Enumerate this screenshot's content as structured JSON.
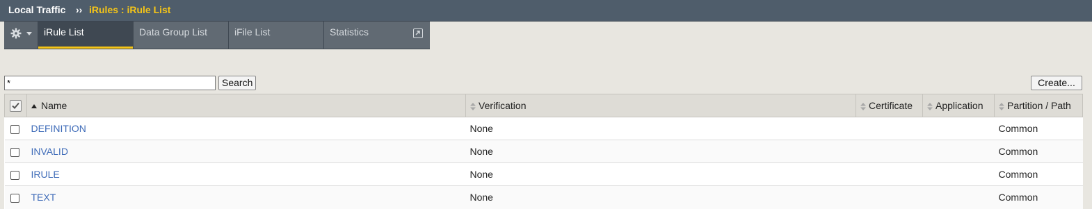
{
  "breadcrumb": {
    "root": "Local Traffic",
    "separator": "››",
    "current": "iRules : iRule List"
  },
  "tabs": [
    {
      "label": "iRule List",
      "active": true
    },
    {
      "label": "Data Group List",
      "active": false
    },
    {
      "label": "iFile List",
      "active": false
    },
    {
      "label": "Statistics",
      "active": false
    }
  ],
  "toolbar": {
    "search_value": "*",
    "search_label": "Search",
    "create_label": "Create..."
  },
  "table": {
    "headers": {
      "name": "Name",
      "verification": "Verification",
      "certificate": "Certificate",
      "application": "Application",
      "partition": "Partition / Path"
    },
    "rows": [
      {
        "name": "DEFINITION",
        "verification": "None",
        "certificate": "",
        "application": "",
        "partition": "Common"
      },
      {
        "name": "INVALID",
        "verification": "None",
        "certificate": "",
        "application": "",
        "partition": "Common"
      },
      {
        "name": "IRULE",
        "verification": "None",
        "certificate": "",
        "application": "",
        "partition": "Common"
      },
      {
        "name": "TEXT",
        "verification": "None",
        "certificate": "",
        "application": "",
        "partition": "Common"
      }
    ]
  },
  "icons": {
    "settings": "gear-icon",
    "menu": "caret-down-icon",
    "external": "external-link-icon",
    "sort": "sort-arrows-icon"
  },
  "colors": {
    "header_bar": "#4f5d6b",
    "accent": "#f5c518",
    "link": "#3e6bb8"
  }
}
